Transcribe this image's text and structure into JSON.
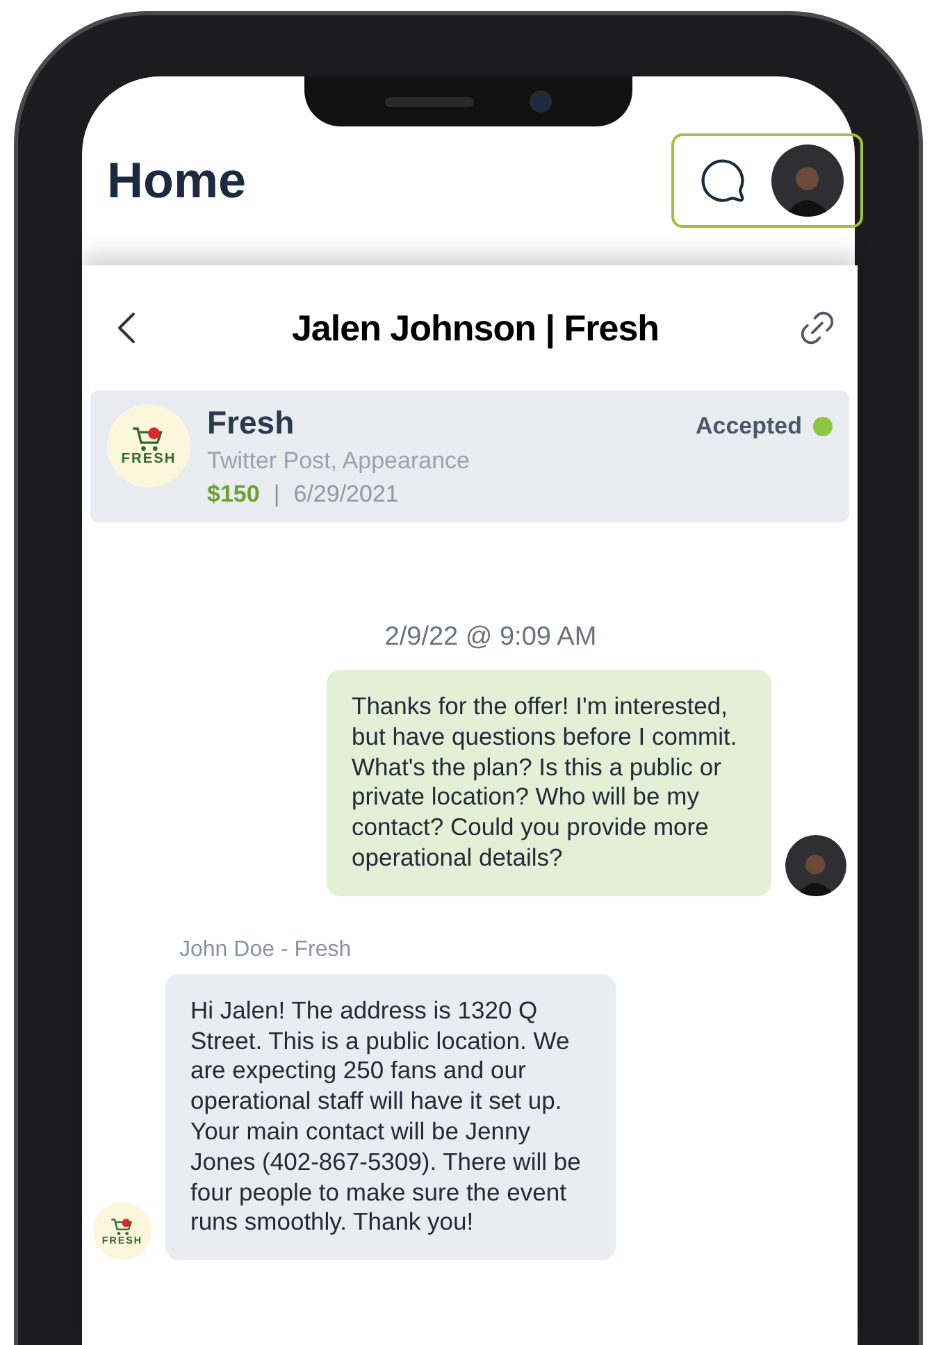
{
  "header": {
    "title": "Home"
  },
  "conversation": {
    "title": "Jalen Johnson | Fresh"
  },
  "offer": {
    "logo_text": "FRESH",
    "brand": "Fresh",
    "deliverables": "Twitter Post, Appearance",
    "amount": "$150",
    "separator": "|",
    "date": "6/29/2021",
    "status": "Accepted"
  },
  "messages": [
    {
      "kind": "timestamp",
      "text": "2/9/22 @ 9:09 AM"
    },
    {
      "kind": "outgoing",
      "text": "Thanks for the offer! I'm interested, but have questions before I commit. What's the plan? Is this a public or private location? Who will be my contact? Could you provide more operational details?"
    },
    {
      "kind": "incoming",
      "sender": "John Doe - Fresh",
      "logo_text": "FRESH",
      "text": "Hi Jalen! The address is 1320 Q Street. This is a public location. We are expecting 250 fans and our operational staff will have it set up. Your main contact will be Jenny Jones (402-867-5309). There will be four people to make sure the event runs smoothly. Thank you!"
    }
  ]
}
